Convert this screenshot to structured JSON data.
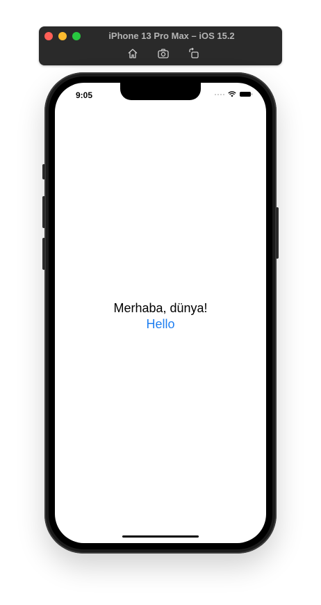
{
  "simulator": {
    "title": "iPhone 13 Pro Max – iOS 15.2",
    "tools": [
      "home-icon",
      "screenshot-icon",
      "rotate-icon"
    ]
  },
  "status_bar": {
    "time": "9:05"
  },
  "content": {
    "greeting": "Merhaba, dünya!",
    "link": "Hello"
  },
  "colors": {
    "link": "#1e7ef0",
    "toolbar": "#2a2a2a"
  }
}
